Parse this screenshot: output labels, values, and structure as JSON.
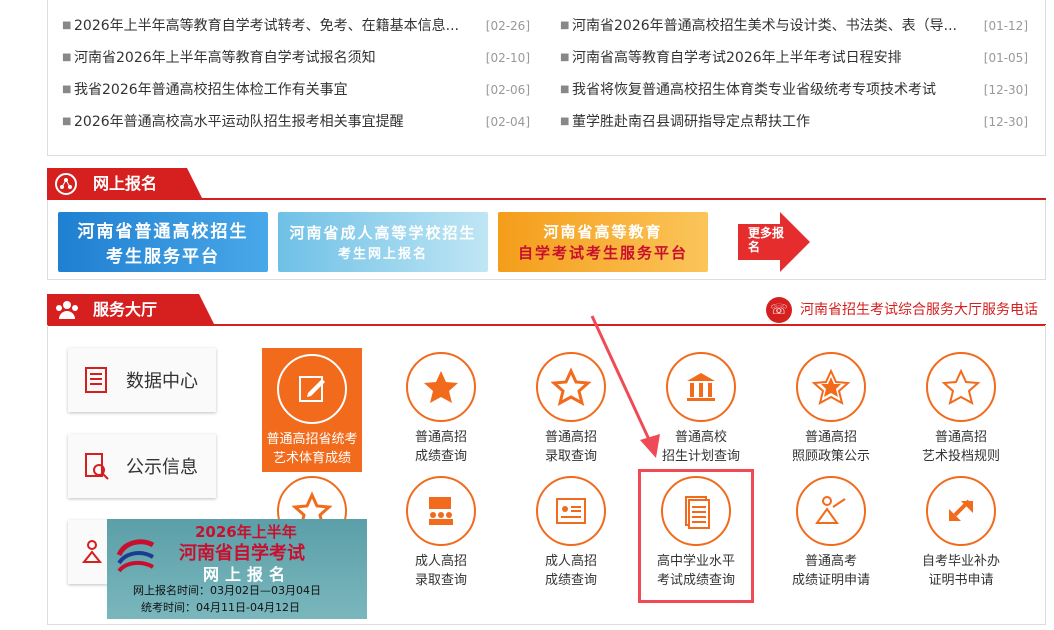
{
  "news": {
    "left": [
      {
        "title": "2026年上半年高等教育自学考试转考、免考、在籍基本信息...",
        "date": "[02-26]"
      },
      {
        "title": "河南省2026年上半年高等教育自学考试报名须知",
        "date": "[02-10]"
      },
      {
        "title": "我省2026年普通高校招生体检工作有关事宜",
        "date": "[02-06]"
      },
      {
        "title": "2026年普通高校高水平运动队招生报考相关事宜提醒",
        "date": "[02-04]"
      }
    ],
    "right": [
      {
        "title": "河南省2026年普通高校招生美术与设计类、书法类、表（导...",
        "date": "[01-12]"
      },
      {
        "title": "河南省高等教育自学考试2026年上半年考试日程安排",
        "date": "[01-05]"
      },
      {
        "title": "我省将恢复普通高校招生体育类专业省级统考专项技术考试",
        "date": "[12-30]"
      },
      {
        "title": "董学胜赴南召县调研指导定点帮扶工作",
        "date": "[12-30]"
      }
    ]
  },
  "online": {
    "title": "网上报名",
    "banners": [
      {
        "line1": "河南省普通高校招生",
        "line2": "考生服务平台"
      },
      {
        "line1": "河南省成人高等学校招生",
        "line2": "考生网上报名"
      },
      {
        "line1": "河南省高等教育",
        "line2": "自学考试考生服务平台"
      }
    ],
    "more": "更多报名"
  },
  "service": {
    "title": "服务大厅",
    "phone": "河南省招生考试综合服务大厅服务电话",
    "side": [
      {
        "label": "数据中心"
      },
      {
        "label": "公示信息"
      }
    ],
    "tiles": [
      {
        "label1": "普通高招省统考",
        "label2": "艺术体育成绩",
        "icon": "edit-icon"
      },
      {
        "label1": "普通高招",
        "label2": "成绩查询",
        "icon": "star-solid-icon"
      },
      {
        "label1": "普通高招",
        "label2": "录取查询",
        "icon": "star-outline-icon"
      },
      {
        "label1": "普通高校",
        "label2": "招生计划查询",
        "icon": "building-icon"
      },
      {
        "label1": "普通高招",
        "label2": "照顾政策公示",
        "icon": "star-double-icon"
      },
      {
        "label1": "普通高招",
        "label2": "艺术投档规则",
        "icon": "star-line-icon"
      },
      {
        "label1": "成人高招",
        "label2": "录取查询",
        "icon": "group-icon"
      },
      {
        "label1": "成人高招",
        "label2": "成绩查询",
        "icon": "certificate-icon"
      },
      {
        "label1": "高中学业水平",
        "label2": "考试成绩查询",
        "icon": "document-stack-icon"
      },
      {
        "label1": "普通高考",
        "label2": "成绩证明申请",
        "icon": "teacher-icon"
      },
      {
        "label1": "自考毕业补办",
        "label2": "证明书申请",
        "icon": "expand-arrow-icon"
      }
    ],
    "promo": {
      "line1": "2026年上半年",
      "line2": "河南省自学考试",
      "line3": "网上报名",
      "line4": "网上报名时间：03月02日—03月04日",
      "line5": "统考时间：04月11日-04月12日"
    }
  },
  "colors": {
    "accent": "#d61f1f",
    "orange": "#f26b1d",
    "highlight": "#ef4a55"
  }
}
